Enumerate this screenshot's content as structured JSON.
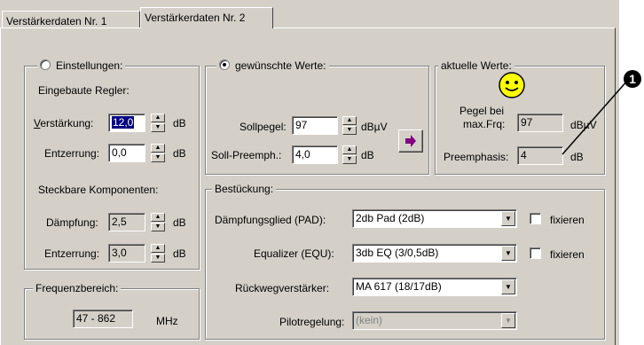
{
  "tabs": [
    {
      "label": "Verstärkerdaten Nr. 1",
      "active": false
    },
    {
      "label": "Verstärkerdaten Nr. 2",
      "active": true
    }
  ],
  "settings": {
    "legend": "Einstellungen:",
    "radio_selected": false,
    "builtin_heading": "Eingebaute Regler:",
    "gain": {
      "label_u": "V",
      "label_rest": "erstärkung:",
      "value": "12,0",
      "unit": "dB"
    },
    "equalization": {
      "label": "Entzerrung:",
      "value": "0,0",
      "unit": "dB"
    },
    "plugin_heading": "Steckbare Komponenten:",
    "attenuation": {
      "label": "Dämpfung:",
      "value": "2,5",
      "unit": "dB"
    },
    "equalization2": {
      "label": "Entzerrung:",
      "value": "3,0",
      "unit": "dB"
    }
  },
  "frequency": {
    "legend": "Frequenzbereich:",
    "value": "47 - 862",
    "unit": "MHz"
  },
  "desired": {
    "legend": "gewünschte Werte:",
    "radio_selected": true,
    "level": {
      "label": "Sollpegel:",
      "value": "97",
      "unit": "dBµV"
    },
    "preemph": {
      "label": "Soll-Preemph.:",
      "value": "4,0",
      "unit": "dB"
    },
    "apply_icon": "right-arrow-icon"
  },
  "current": {
    "legend": "aktuelle Werte:",
    "smiley_icon": "smiley-face-icon",
    "level_label_line1": "Pegel bei",
    "level_label_line2": "max.Frq:",
    "level_value": "97",
    "level_unit": "dBµV",
    "preemph_label": "Preemphasis:",
    "preemph_value": "4",
    "preemph_unit": "dB"
  },
  "equipment": {
    "legend": "Bestückung:",
    "pad": {
      "label": "Dämpfungsglied (PAD):",
      "value": "2db Pad  (2dB)",
      "fix_label": "fixieren"
    },
    "equ": {
      "label": "Equalizer (EQU):",
      "value": "3db EQ (3/0,5dB)",
      "fix_label": "fixieren"
    },
    "return_amp": {
      "label": "Rückwegverstärker:",
      "value": "MA 617 (18/17dB)"
    },
    "pilot": {
      "label": "Pilotregelung:",
      "value": "(kein)"
    }
  },
  "callout": {
    "number": "1"
  },
  "colors": {
    "dialog_bg": "#d4d0c8",
    "selection": "#000080",
    "smiley_yellow": "#ffff00",
    "arrow_purple": "#800080"
  }
}
